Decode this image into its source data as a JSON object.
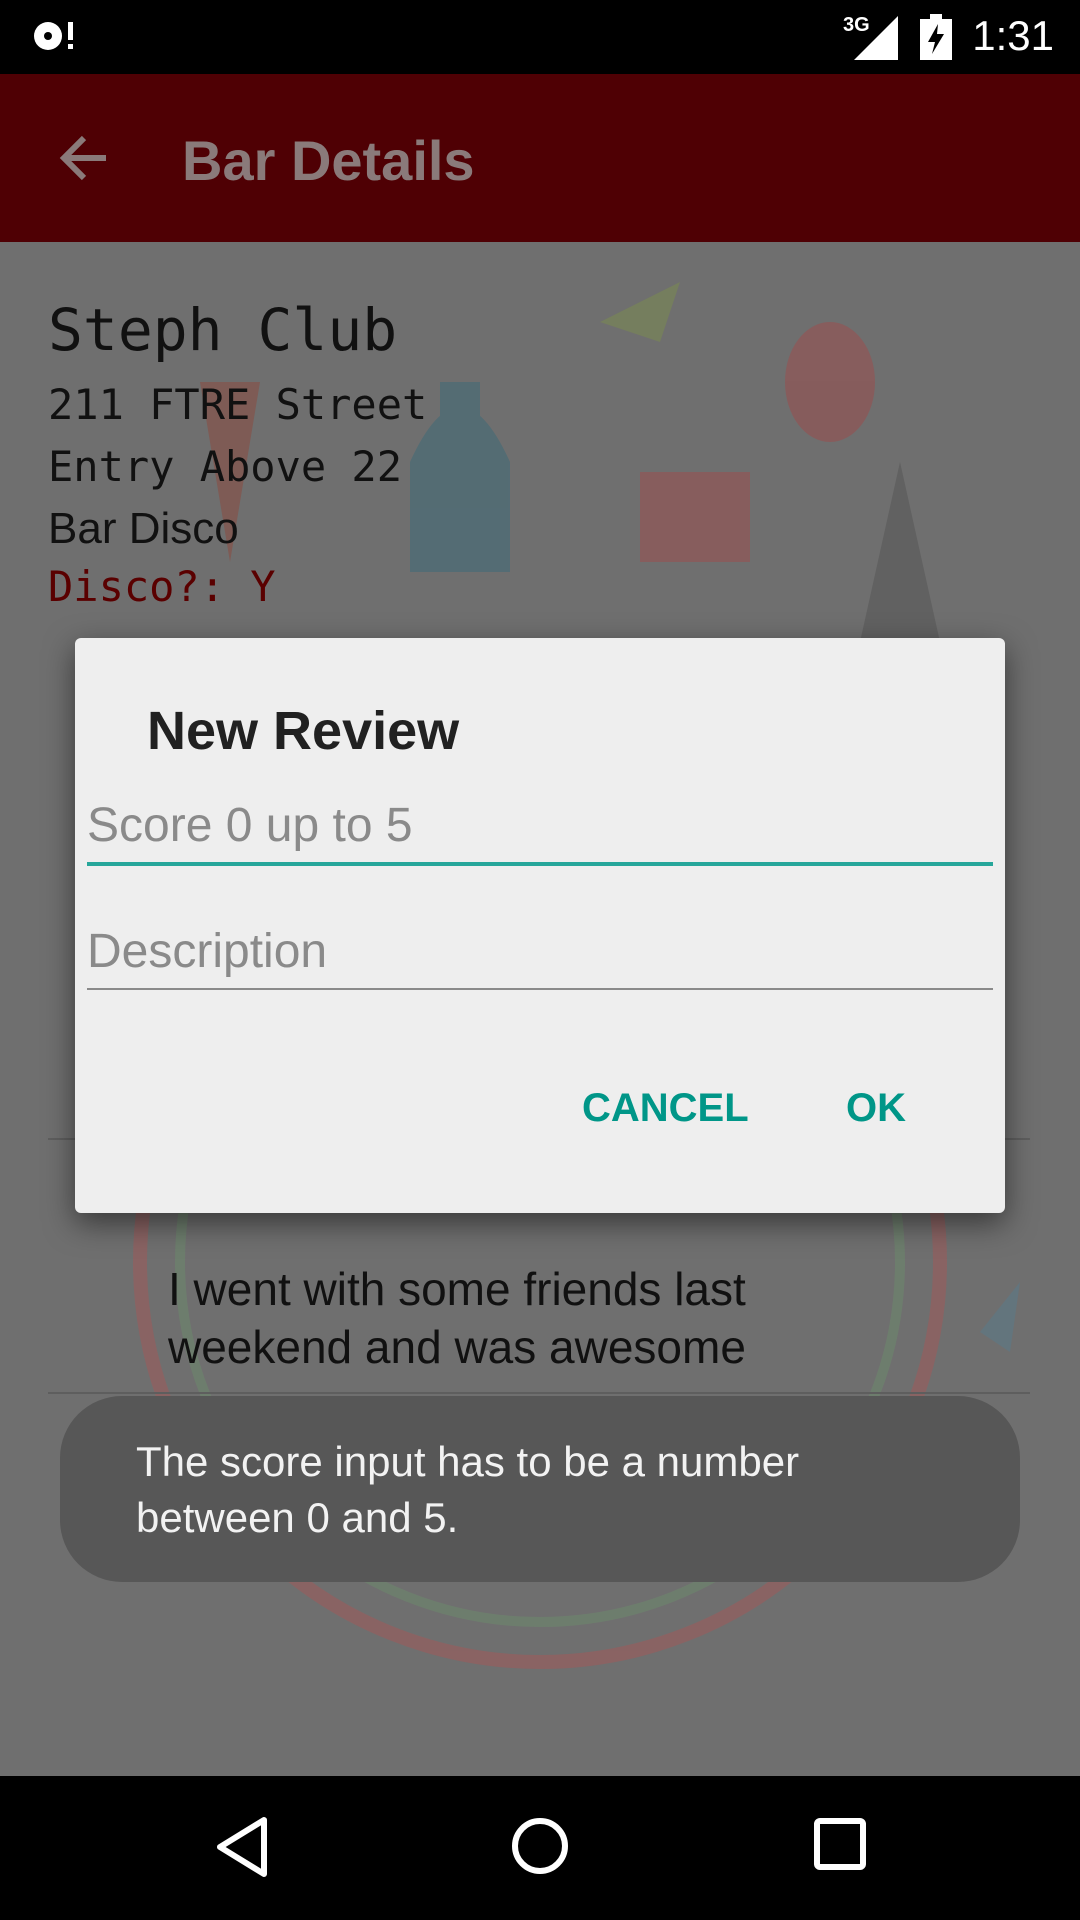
{
  "status_bar": {
    "time": "1:31",
    "network": "3G",
    "icons": [
      "notification-icon",
      "signal-icon",
      "battery-charging-icon"
    ]
  },
  "app_bar": {
    "title": "Bar Details",
    "back_icon": "arrow-back-icon"
  },
  "bar": {
    "name": "Steph Club",
    "address": "211 FTRE Street",
    "entry": "Entry Above 22",
    "type": "Bar Disco",
    "disco": "Disco?: Y"
  },
  "review": {
    "text": "I went with some friends last weekend and was awesome"
  },
  "dialog": {
    "title": "New Review",
    "score_placeholder": "Score 0 up to 5",
    "description_placeholder": "Description",
    "cancel_label": "CANCEL",
    "ok_label": "OK"
  },
  "toast": {
    "message": "The score input has to be a number between 0 and 5."
  },
  "nav_bar": {
    "icons": [
      "back-triangle-icon",
      "home-circle-icon",
      "recents-square-icon"
    ]
  },
  "colors": {
    "app_bar": "#4f0004",
    "accent": "#009688",
    "disco_text": "#5a0000"
  }
}
